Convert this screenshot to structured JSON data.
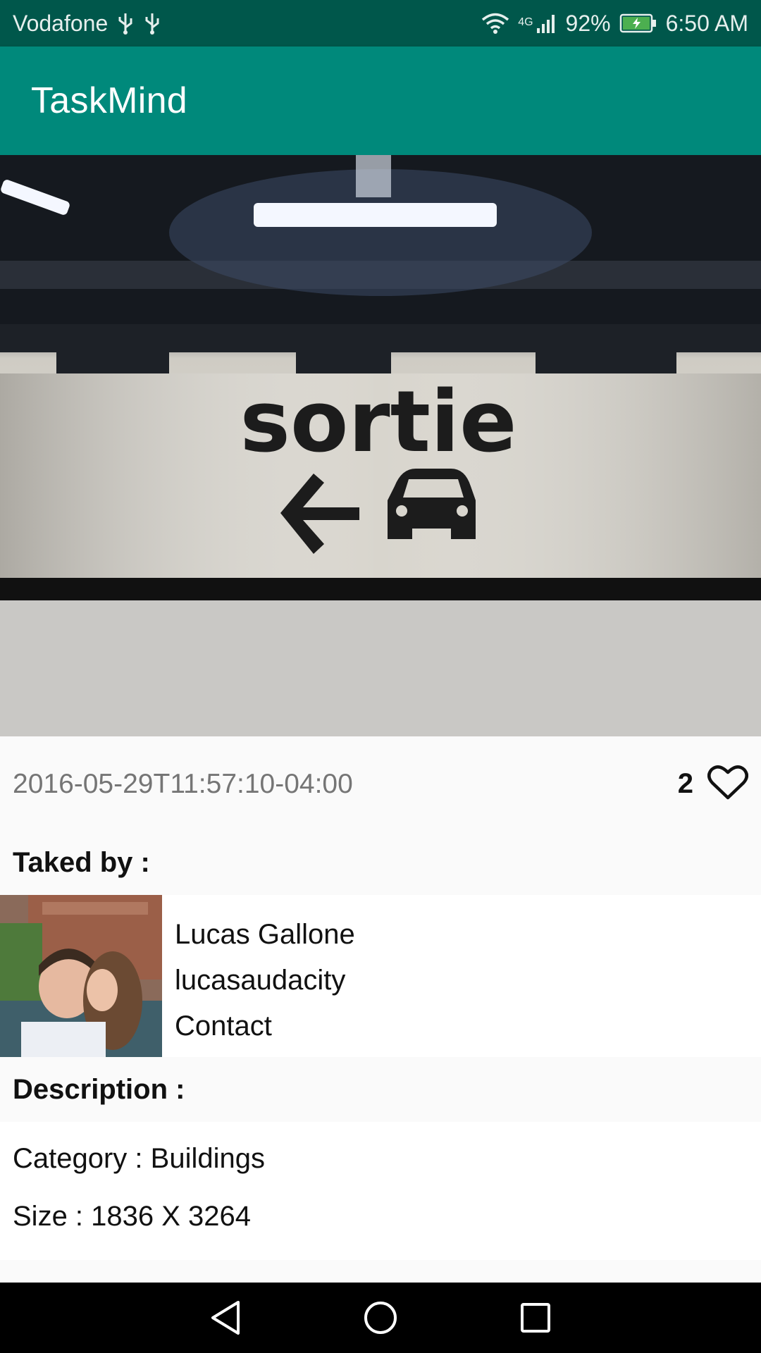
{
  "status_bar": {
    "carrier": "Vodafone",
    "network": "4G",
    "battery": "92%",
    "time": "6:50 AM",
    "icons": [
      "usb-icon",
      "usb-icon",
      "wifi-icon",
      "signal-icon",
      "battery-charging-icon"
    ]
  },
  "app_bar": {
    "title": "TaskMind"
  },
  "photo": {
    "sign_text": "sortie",
    "icons": [
      "arrow-left-icon",
      "car-icon"
    ]
  },
  "meta": {
    "timestamp": "2016-05-29T11:57:10-04:00",
    "likes": "2",
    "like_icon": "heart-outline-icon"
  },
  "author_section": {
    "label": "Taked by :",
    "name": "Lucas Gallone",
    "username": "lucasaudacity",
    "contact": "Contact"
  },
  "description_section": {
    "label": "Description :",
    "category": "Category : Buildings",
    "size": "Size : 1836 X 3264"
  },
  "nav_bar": {
    "buttons": [
      "back-icon",
      "home-icon",
      "recents-icon"
    ]
  },
  "colors": {
    "status_bar": "#00574b",
    "app_bar": "#00897b",
    "background": "#fafafa"
  }
}
